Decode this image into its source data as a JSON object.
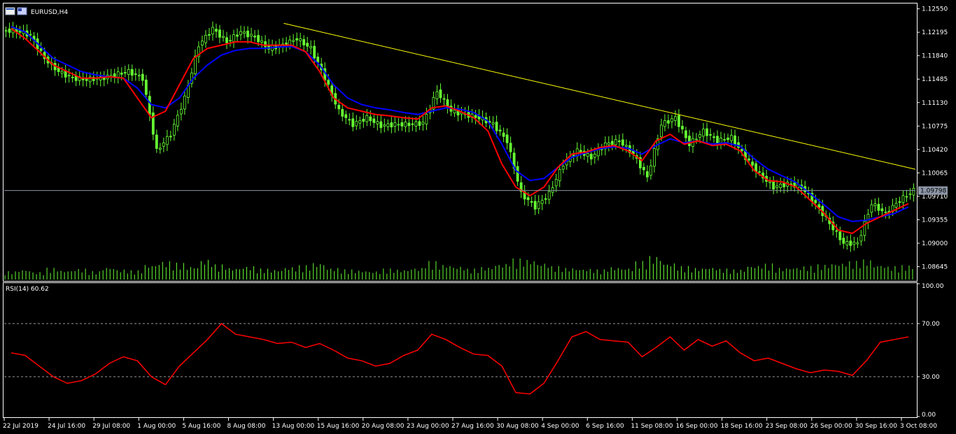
{
  "chart_data": [
    {
      "type": "line",
      "title": "EURUSD,H4",
      "symbol": "EURUSD",
      "timeframe": "H4",
      "bar_style": "candlestick",
      "colors": {
        "background": "#000000",
        "axis": "#ffffff",
        "candle": "#66ff33",
        "fast_ma": "#ff0000",
        "slow_ma": "#0000ff",
        "trendline": "#ffff00",
        "volume": "#66ff33",
        "bid_line": "#8c96a6",
        "price_tag": "#8c96a6"
      },
      "ylim": [
        1.0845,
        1.1262
      ],
      "y_ticks": [
        "1.12550",
        "1.12195",
        "1.11840",
        "1.11485",
        "1.11130",
        "1.10775",
        "1.10420",
        "1.10065",
        "1.09710",
        "1.09355",
        "1.09000",
        "1.08645"
      ],
      "current_price": "1.09798",
      "x_ticks": [
        "22 Jul 2019",
        "24 Jul 16:00",
        "29 Jul 08:00",
        "1 Aug 00:00",
        "5 Aug 16:00",
        "8 Aug 08:00",
        "13 Aug 00:00",
        "15 Aug 16:00",
        "20 Aug 08:00",
        "23 Aug 00:00",
        "27 Aug 16:00",
        "30 Aug 08:00",
        "4 Sep 00:00",
        "6 Sep 16:00",
        "11 Sep 08:00",
        "16 Sep 00:00",
        "18 Sep 16:00",
        "23 Sep 08:00",
        "26 Sep 00:00",
        "30 Sep 16:00",
        "3 Oct 08:00"
      ],
      "series": [
        {
          "name": "close",
          "values": [
            1.1222,
            1.1215,
            1.118,
            1.116,
            1.115,
            1.1148,
            1.115,
            1.1155,
            1.116,
            1.115,
            1.104,
            1.1065,
            1.112,
            1.12,
            1.1225,
            1.1205,
            1.122,
            1.1212,
            1.1195,
            1.12,
            1.121,
            1.1195,
            1.115,
            1.11,
            1.108,
            1.109,
            1.1078,
            1.108,
            1.108,
            1.1082,
            1.113,
            1.11,
            1.1095,
            1.109,
            1.108,
            1.1055,
            1.0975,
            1.0955,
            1.0975,
            1.102,
            1.104,
            1.103,
            1.105,
            1.1055,
            1.1035,
            1.1,
            1.108,
            1.109,
            1.105,
            1.107,
            1.1055,
            1.106,
            1.103,
            1.1005,
            1.0985,
            1.099,
            1.0985,
            1.096,
            1.093,
            1.09,
            1.09,
            1.096,
            1.0945,
            1.0965,
            1.098
          ]
        },
        {
          "name": "fast_ma",
          "values": [
            1.1225,
            1.121,
            1.119,
            1.117,
            1.116,
            1.115,
            1.115,
            1.1152,
            1.115,
            1.112,
            1.109,
            1.11,
            1.114,
            1.118,
            1.1195,
            1.12,
            1.1205,
            1.1205,
            1.12,
            1.12,
            1.12,
            1.119,
            1.116,
            1.112,
            1.1105,
            1.11,
            1.1095,
            1.1093,
            1.109,
            1.1088,
            1.1105,
            1.1108,
            1.11,
            1.109,
            1.107,
            1.102,
            1.0985,
            1.0972,
            1.0985,
            1.1015,
            1.1035,
            1.1038,
            1.1045,
            1.1048,
            1.104,
            1.1025,
            1.1055,
            1.1065,
            1.105,
            1.1055,
            1.1048,
            1.105,
            1.104,
            1.101,
            1.0995,
            1.0993,
            1.0985,
            1.0965,
            1.0945,
            1.092,
            1.0915,
            1.093,
            1.094,
            1.095,
            1.096
          ]
        },
        {
          "name": "slow_ma",
          "values": [
            1.1228,
            1.122,
            1.12,
            1.118,
            1.117,
            1.116,
            1.1155,
            1.1152,
            1.115,
            1.1135,
            1.111,
            1.1105,
            1.112,
            1.115,
            1.117,
            1.1185,
            1.1192,
            1.1195,
            1.1195,
            1.1197,
            1.1198,
            1.119,
            1.117,
            1.114,
            1.112,
            1.111,
            1.1105,
            1.1102,
            1.1098,
            1.1095,
            1.11,
            1.1105,
            1.1103,
            1.1098,
            1.1085,
            1.105,
            1.101,
            1.0995,
            1.0998,
            1.1015,
            1.103,
            1.1037,
            1.1043,
            1.1046,
            1.1044,
            1.1035,
            1.1048,
            1.1058,
            1.1052,
            1.1055,
            1.105,
            1.1052,
            1.1047,
            1.1028,
            1.1012,
            1.1002,
            1.0992,
            1.0975,
            1.0958,
            1.094,
            1.0933,
            1.0935,
            1.094,
            1.0945,
            1.0955
          ]
        },
        {
          "name": "volume",
          "values": [
            10,
            12,
            9,
            14,
            11,
            13,
            10,
            15,
            12,
            11,
            18,
            22,
            20,
            16,
            24,
            18,
            14,
            16,
            13,
            12,
            15,
            17,
            20,
            14,
            12,
            11,
            10,
            13,
            12,
            14,
            22,
            18,
            16,
            13,
            15,
            19,
            25,
            24,
            20,
            16,
            14,
            13,
            12,
            15,
            14,
            22,
            28,
            20,
            16,
            14,
            15,
            13,
            12,
            17,
            19,
            14,
            15,
            16,
            18,
            20,
            22,
            24,
            18,
            16,
            17
          ]
        }
      ],
      "trendline": {
        "from": [
          0.3068,
          1.1233
        ],
        "to": [
          1.0,
          1.1012
        ]
      }
    },
    {
      "type": "line",
      "title": "RSI(14) 60.62",
      "ylim": [
        0,
        100
      ],
      "y_ticks": [
        "100.00",
        "70.00",
        "30.00",
        "0.00"
      ],
      "levels": [
        70,
        30
      ],
      "series": [
        {
          "name": "RSI(14)",
          "values": [
            48,
            46,
            38,
            30,
            25,
            27,
            32,
            40,
            45,
            42,
            30,
            24,
            38,
            48,
            58,
            70,
            62,
            60,
            58,
            55,
            56,
            52,
            55,
            50,
            44,
            42,
            38,
            40,
            46,
            50,
            62,
            58,
            52,
            47,
            46,
            38,
            18,
            17,
            25,
            42,
            60,
            64,
            58,
            57,
            56,
            45,
            52,
            60,
            50,
            58,
            53,
            57,
            48,
            42,
            44,
            40,
            36,
            33,
            35,
            34,
            31,
            42,
            56,
            58,
            60
          ]
        }
      ]
    }
  ]
}
